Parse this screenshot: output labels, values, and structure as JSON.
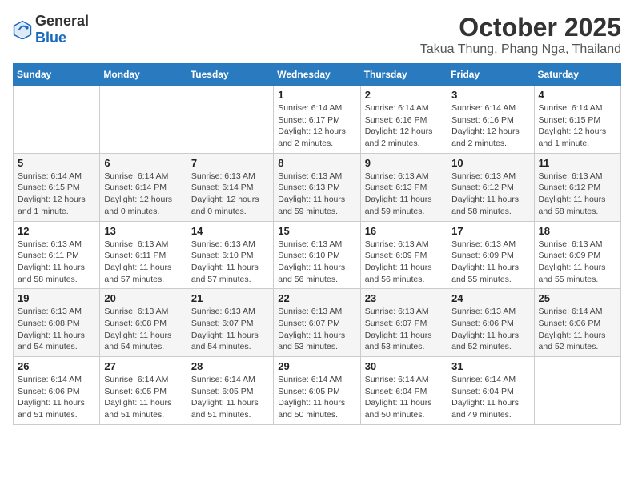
{
  "header": {
    "logo": {
      "general": "General",
      "blue": "Blue"
    },
    "title": "October 2025",
    "subtitle": "Takua Thung, Phang Nga, Thailand"
  },
  "weekdays": [
    "Sunday",
    "Monday",
    "Tuesday",
    "Wednesday",
    "Thursday",
    "Friday",
    "Saturday"
  ],
  "weeks": [
    [
      {
        "day": "",
        "info": ""
      },
      {
        "day": "",
        "info": ""
      },
      {
        "day": "",
        "info": ""
      },
      {
        "day": "1",
        "info": "Sunrise: 6:14 AM\nSunset: 6:17 PM\nDaylight: 12 hours\nand 2 minutes."
      },
      {
        "day": "2",
        "info": "Sunrise: 6:14 AM\nSunset: 6:16 PM\nDaylight: 12 hours\nand 2 minutes."
      },
      {
        "day": "3",
        "info": "Sunrise: 6:14 AM\nSunset: 6:16 PM\nDaylight: 12 hours\nand 2 minutes."
      },
      {
        "day": "4",
        "info": "Sunrise: 6:14 AM\nSunset: 6:15 PM\nDaylight: 12 hours\nand 1 minute."
      }
    ],
    [
      {
        "day": "5",
        "info": "Sunrise: 6:14 AM\nSunset: 6:15 PM\nDaylight: 12 hours\nand 1 minute."
      },
      {
        "day": "6",
        "info": "Sunrise: 6:14 AM\nSunset: 6:14 PM\nDaylight: 12 hours\nand 0 minutes."
      },
      {
        "day": "7",
        "info": "Sunrise: 6:13 AM\nSunset: 6:14 PM\nDaylight: 12 hours\nand 0 minutes."
      },
      {
        "day": "8",
        "info": "Sunrise: 6:13 AM\nSunset: 6:13 PM\nDaylight: 11 hours\nand 59 minutes."
      },
      {
        "day": "9",
        "info": "Sunrise: 6:13 AM\nSunset: 6:13 PM\nDaylight: 11 hours\nand 59 minutes."
      },
      {
        "day": "10",
        "info": "Sunrise: 6:13 AM\nSunset: 6:12 PM\nDaylight: 11 hours\nand 58 minutes."
      },
      {
        "day": "11",
        "info": "Sunrise: 6:13 AM\nSunset: 6:12 PM\nDaylight: 11 hours\nand 58 minutes."
      }
    ],
    [
      {
        "day": "12",
        "info": "Sunrise: 6:13 AM\nSunset: 6:11 PM\nDaylight: 11 hours\nand 58 minutes."
      },
      {
        "day": "13",
        "info": "Sunrise: 6:13 AM\nSunset: 6:11 PM\nDaylight: 11 hours\nand 57 minutes."
      },
      {
        "day": "14",
        "info": "Sunrise: 6:13 AM\nSunset: 6:10 PM\nDaylight: 11 hours\nand 57 minutes."
      },
      {
        "day": "15",
        "info": "Sunrise: 6:13 AM\nSunset: 6:10 PM\nDaylight: 11 hours\nand 56 minutes."
      },
      {
        "day": "16",
        "info": "Sunrise: 6:13 AM\nSunset: 6:09 PM\nDaylight: 11 hours\nand 56 minutes."
      },
      {
        "day": "17",
        "info": "Sunrise: 6:13 AM\nSunset: 6:09 PM\nDaylight: 11 hours\nand 55 minutes."
      },
      {
        "day": "18",
        "info": "Sunrise: 6:13 AM\nSunset: 6:09 PM\nDaylight: 11 hours\nand 55 minutes."
      }
    ],
    [
      {
        "day": "19",
        "info": "Sunrise: 6:13 AM\nSunset: 6:08 PM\nDaylight: 11 hours\nand 54 minutes."
      },
      {
        "day": "20",
        "info": "Sunrise: 6:13 AM\nSunset: 6:08 PM\nDaylight: 11 hours\nand 54 minutes."
      },
      {
        "day": "21",
        "info": "Sunrise: 6:13 AM\nSunset: 6:07 PM\nDaylight: 11 hours\nand 54 minutes."
      },
      {
        "day": "22",
        "info": "Sunrise: 6:13 AM\nSunset: 6:07 PM\nDaylight: 11 hours\nand 53 minutes."
      },
      {
        "day": "23",
        "info": "Sunrise: 6:13 AM\nSunset: 6:07 PM\nDaylight: 11 hours\nand 53 minutes."
      },
      {
        "day": "24",
        "info": "Sunrise: 6:13 AM\nSunset: 6:06 PM\nDaylight: 11 hours\nand 52 minutes."
      },
      {
        "day": "25",
        "info": "Sunrise: 6:14 AM\nSunset: 6:06 PM\nDaylight: 11 hours\nand 52 minutes."
      }
    ],
    [
      {
        "day": "26",
        "info": "Sunrise: 6:14 AM\nSunset: 6:06 PM\nDaylight: 11 hours\nand 51 minutes."
      },
      {
        "day": "27",
        "info": "Sunrise: 6:14 AM\nSunset: 6:05 PM\nDaylight: 11 hours\nand 51 minutes."
      },
      {
        "day": "28",
        "info": "Sunrise: 6:14 AM\nSunset: 6:05 PM\nDaylight: 11 hours\nand 51 minutes."
      },
      {
        "day": "29",
        "info": "Sunrise: 6:14 AM\nSunset: 6:05 PM\nDaylight: 11 hours\nand 50 minutes."
      },
      {
        "day": "30",
        "info": "Sunrise: 6:14 AM\nSunset: 6:04 PM\nDaylight: 11 hours\nand 50 minutes."
      },
      {
        "day": "31",
        "info": "Sunrise: 6:14 AM\nSunset: 6:04 PM\nDaylight: 11 hours\nand 49 minutes."
      },
      {
        "day": "",
        "info": ""
      }
    ]
  ]
}
